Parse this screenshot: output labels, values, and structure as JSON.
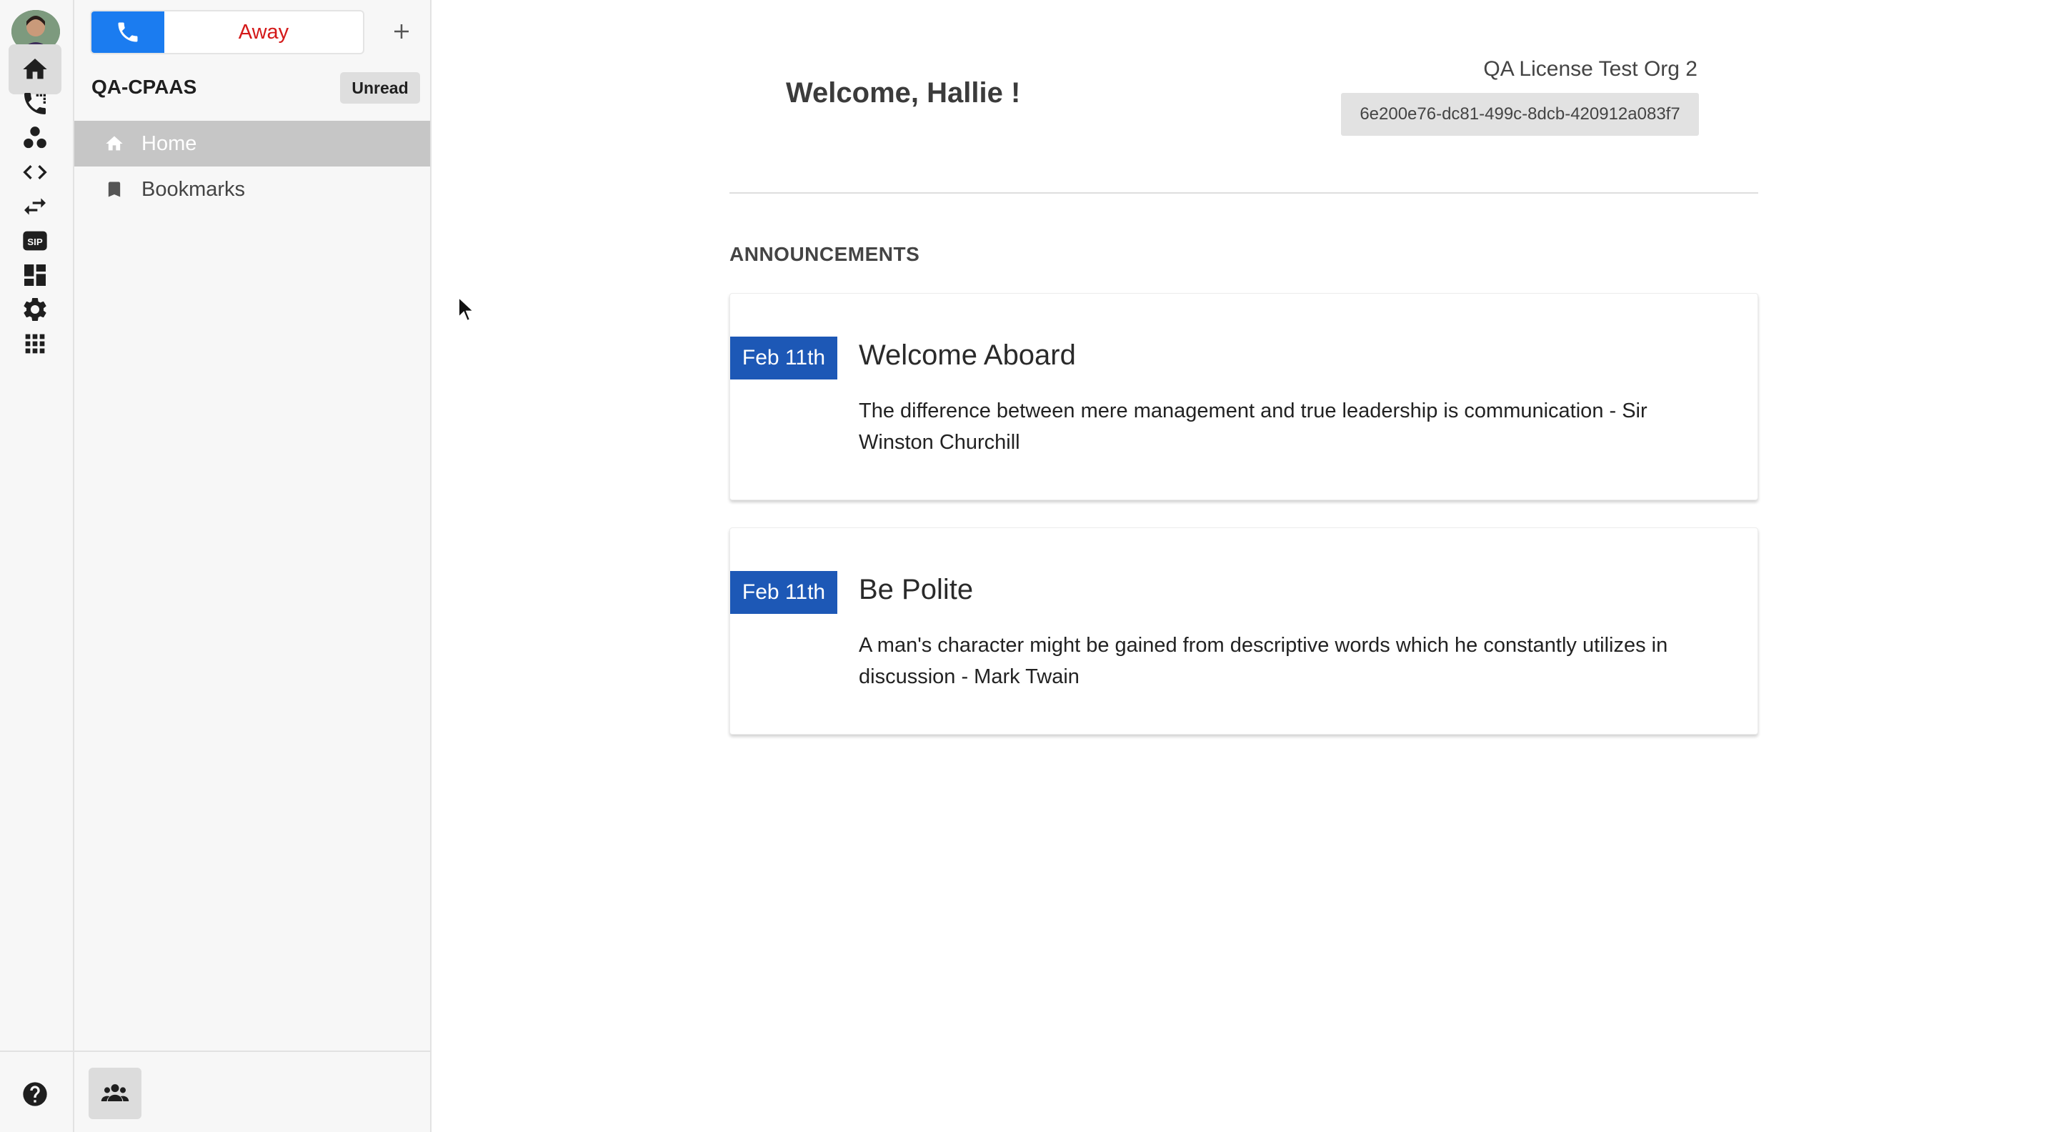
{
  "rail": {
    "items": [
      {
        "name": "home",
        "icon": "home-icon",
        "active": true
      },
      {
        "name": "calls",
        "icon": "phone-log-icon"
      },
      {
        "name": "contacts",
        "icon": "team-dots-icon"
      },
      {
        "name": "api",
        "icon": "code-icon"
      },
      {
        "name": "transfer",
        "icon": "swap-arrows-icon"
      },
      {
        "name": "sip",
        "icon": "sip-icon"
      },
      {
        "name": "dashboard",
        "icon": "dashboard-icon"
      },
      {
        "name": "settings",
        "icon": "gear-icon"
      },
      {
        "name": "apps",
        "icon": "grid-icon"
      }
    ],
    "help_icon": "help-icon"
  },
  "sidebar": {
    "status_label": "Away",
    "org_name": "QA-CPAAS",
    "unread_label": "Unread",
    "nav": [
      {
        "label": "Home",
        "icon": "home-icon",
        "active": true
      },
      {
        "label": "Bookmarks",
        "icon": "bookmark-icon",
        "active": false
      }
    ]
  },
  "main": {
    "welcome": "Welcome, Hallie !",
    "org_title": "QA License Test Org 2",
    "org_id": "6e200e76-dc81-499c-8dcb-420912a083f7",
    "section_title": "ANNOUNCEMENTS",
    "announcements": [
      {
        "date": "Feb 11th",
        "title": "Welcome Aboard",
        "body": "The difference between mere management and true leadership is communication - Sir Winston Churchill"
      },
      {
        "date": "Feb 11th",
        "title": "Be Polite",
        "body": "A man's character might be gained from descriptive words which he constantly utilizes in discussion - Mark Twain"
      }
    ]
  },
  "colors": {
    "accent_blue": "#1b7cf0",
    "date_badge": "#1d58b6",
    "away_red": "#d41919",
    "active_nav": "#c6c6c6"
  }
}
